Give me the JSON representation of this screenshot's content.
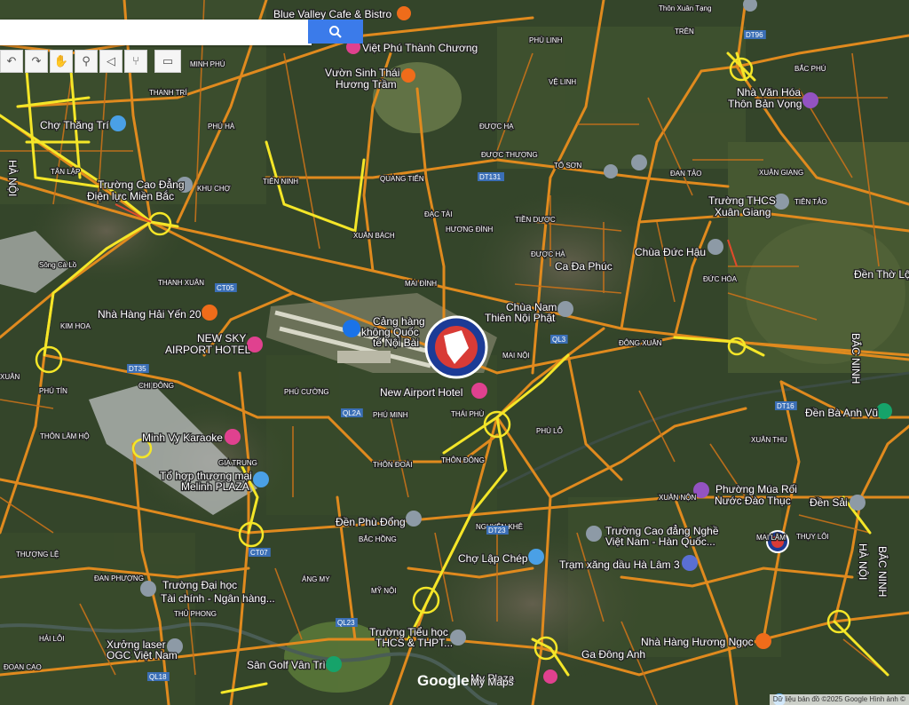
{
  "search": {
    "placeholder": ""
  },
  "toolbar": {
    "undo": "↶",
    "redo": "↷",
    "pan": "✋",
    "marker": "⚲",
    "polygon": "◁",
    "route": "⑂",
    "measure": "▭"
  },
  "pois": [
    {
      "name": "Blue Valley Cafe & Bistro"
    },
    {
      "name": "Việt Phú Thành Chương"
    },
    {
      "name": "Vườn Sinh Thái"
    },
    {
      "name": "Hương Trầm"
    },
    {
      "name": "Chợ Thăng Trí"
    },
    {
      "name": "Trường Cao Đẳng"
    },
    {
      "name": "Điện lực Miền Bắc"
    },
    {
      "name": "Nhà Văn Hóa"
    },
    {
      "name": "Thôn Bản Vọng"
    },
    {
      "name": "Trường THCS"
    },
    {
      "name": "Xuân Giang"
    },
    {
      "name": "Chùa Đức Hậu"
    },
    {
      "name": "Ca Đa Phúc"
    },
    {
      "name": "Chùa Nam"
    },
    {
      "name": "Thiên Nội Phật"
    },
    {
      "name": "Nhà Hàng Hải Yến 20"
    },
    {
      "name": "NEW SKY"
    },
    {
      "name": "AIRPORT HOTEL"
    },
    {
      "name": "Cảng hàng"
    },
    {
      "name": "không Quốc"
    },
    {
      "name": "tế Nội Bài"
    },
    {
      "name": "New Airport Hotel"
    },
    {
      "name": "Đền Thờ Lộ"
    },
    {
      "name": "Đền Bà Anh Vũ"
    },
    {
      "name": "Minh Vy Karaoke"
    },
    {
      "name": "Tổ hợp thương mại"
    },
    {
      "name": "Melinh PLAZA"
    },
    {
      "name": "Phường Múa Rối"
    },
    {
      "name": "Nước Đào Thục"
    },
    {
      "name": "Đền Sải"
    },
    {
      "name": "Đền Phù Đổng"
    },
    {
      "name": "Trường Cao đẳng Nghề"
    },
    {
      "name": "Việt Nam - Hàn Quốc..."
    },
    {
      "name": "Chợ Lập Chép"
    },
    {
      "name": "Trạm xăng dầu Hà Lâm 3"
    },
    {
      "name": "Trường Đại học"
    },
    {
      "name": "Tài chính - Ngân hàng..."
    },
    {
      "name": "Trường Tiểu học"
    },
    {
      "name": "THCS & THPT..."
    },
    {
      "name": "Xưởng laser"
    },
    {
      "name": "OGC Việt Nam"
    },
    {
      "name": "Sân Golf Vân Trì"
    },
    {
      "name": "Nhà Hàng Hương Ngọc"
    },
    {
      "name": "My Plaza"
    },
    {
      "name": "Ga Đông Anh"
    }
  ],
  "places": [
    "MINH PHÚ",
    "THANH TRÍ",
    "PHÚ HÀ",
    "KHU CHỢ",
    "QUANG TIẾN",
    "TIÊN NINH",
    "ĐẠC TÀI",
    "XUÂN BÁCH",
    "HƯƠNG ĐÌNH",
    "TIỀN DƯỢC",
    "ĐƯỢC HÀ",
    "ĐƯỢC THƯỢNG",
    "TỔ SƠN",
    "ĐƯỢC HẠ",
    "VỆ LINH",
    "PHÙ LINH",
    "TRÊN",
    "BẮC PHÚ",
    "XUÂN GIANG",
    "TIÊN TẢO",
    "ĐAN TẢO",
    "ĐỨC HÒA",
    "THANH XUÂN",
    "MAI ĐÌNH",
    "MAI NỘI",
    "ĐÔNG XUÂN",
    "CHI ĐÔNG",
    "PHÚ CƯỜNG",
    "PHÚ MINH",
    "THÁI PHÙ",
    "PHÙ LỖ",
    "THÔN ĐOÀI",
    "THÔN ĐÔNG",
    "XUÂN THU",
    "XUÂN NỘN",
    "THỤY LÔI",
    "NGUYÊN KHÊ",
    "BẮC HỒNG",
    "THÔN LÂM HỘ",
    "GIA TRUNG",
    "KIM HOA",
    "PHÚ TÍN",
    "XUÂN",
    "THƯỢNG LỆ",
    "ÁNG MY",
    "MỸ NỘI",
    "HẢI LỖI",
    "ĐOAN CAO",
    "TÂN LẬP",
    "ĐAN PHƯỢNG",
    "THỦ PHONG",
    "Sông Cà Lồ",
    "Thôn Xuân Tạng",
    "MAI LÂM"
  ],
  "regions": [
    "HÀ NỘI",
    "BẮC NINH"
  ],
  "road_codes": [
    "QL2A",
    "QL3",
    "QL18",
    "DT35",
    "DT96",
    "DT131",
    "DT16",
    "CT05",
    "CT07",
    "DT23",
    "QL23"
  ],
  "logo": "Google",
  "logo_overlay": "My Maps",
  "attribution": "Dữ liệu bản đồ ©2025 Google Hình ảnh ©"
}
